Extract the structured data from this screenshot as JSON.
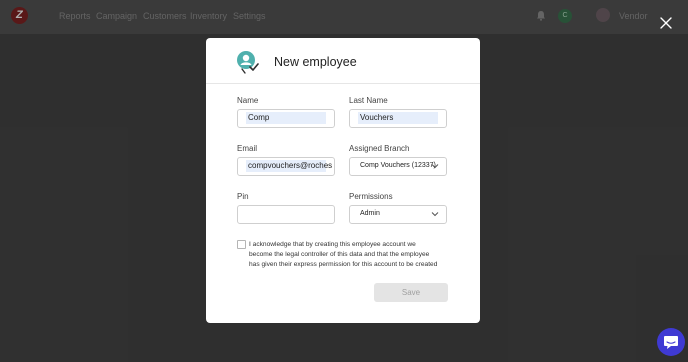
{
  "nav": {
    "items": [
      "Reports",
      "Campaign",
      "Customers",
      "Inventory",
      "Settings"
    ],
    "user_name": "Vendor",
    "badge_initial": "C"
  },
  "modal": {
    "title": "New employee",
    "fields": {
      "name": {
        "label": "Name",
        "value": "Comp"
      },
      "last_name": {
        "label": "Last Name",
        "value": "Vouchers"
      },
      "email": {
        "label": "Email",
        "value": "compvouchers@rochest"
      },
      "branch": {
        "label": "Assigned Branch",
        "value": "Comp Vouchers (12337)"
      },
      "pin": {
        "label": "Pin",
        "value": ""
      },
      "permissions": {
        "label": "Permissions",
        "value": "Admin"
      }
    },
    "acknowledge": {
      "line1": "I acknowledge that by creating this employee account we",
      "line2": "become the legal controller of this data and that the employee",
      "line3": "has given their express permission for this account to be created",
      "checked": false
    },
    "save_label": "Save"
  },
  "colors": {
    "backdrop": "#3a3a3a",
    "modal_bg": "#ffffff",
    "icon_teal": "#4fb0ad",
    "chat_blue": "#3f3ad3",
    "input_highlight": "#e6eefb"
  },
  "icons": {
    "header": "employee-badge-icon",
    "close": "close-icon",
    "chat": "chat-bubble-icon",
    "bell": "bell-icon"
  }
}
